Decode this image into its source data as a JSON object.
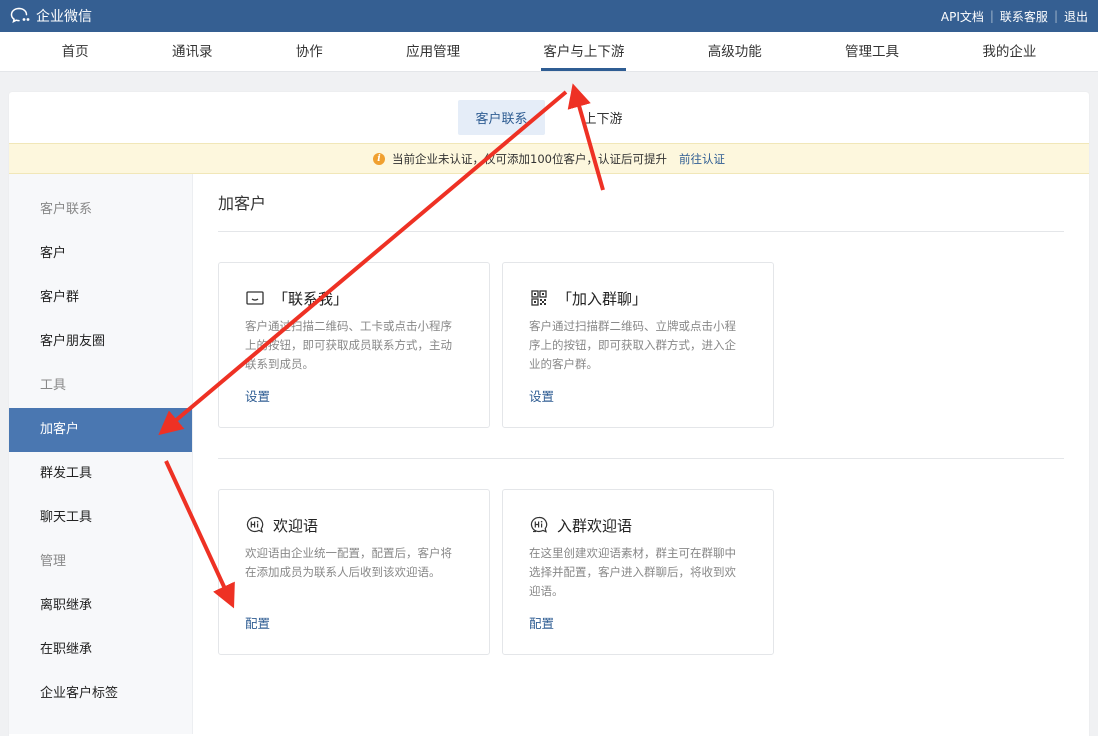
{
  "app": {
    "name": "企业微信"
  },
  "toplinks": {
    "api_docs": "API文档",
    "support": "联系客服",
    "logout": "退出"
  },
  "nav": {
    "items": [
      "首页",
      "通讯录",
      "协作",
      "应用管理",
      "客户与上下游",
      "高级功能",
      "管理工具",
      "我的企业"
    ],
    "active_index": 4
  },
  "subtabs": {
    "items": [
      "客户联系",
      "上下游"
    ],
    "active_index": 0
  },
  "notice": {
    "text": "当前企业未认证，仅可添加100位客户，认证后可提升",
    "link": "前往认证"
  },
  "sidebar": {
    "groups": [
      {
        "title": "客户联系",
        "items": [
          "客户",
          "客户群",
          "客户朋友圈"
        ]
      },
      {
        "title": "工具",
        "items": [
          "加客户",
          "群发工具",
          "聊天工具"
        ]
      },
      {
        "title": "管理",
        "items": [
          "离职继承",
          "在职继承",
          "企业客户标签"
        ]
      }
    ],
    "active": "加客户"
  },
  "page": {
    "title": "加客户"
  },
  "cards": [
    {
      "icon": "contact-me-icon",
      "title": "「联系我」",
      "desc": "客户通过扫描二维码、工卡或点击小程序上的按钮，即可获取成员联系方式，主动联系到成员。",
      "action": "设置"
    },
    {
      "icon": "qr-code-icon",
      "title": "「加入群聊」",
      "desc": "客户通过扫描群二维码、立牌或点击小程序上的按钮，即可获取入群方式，进入企业的客户群。",
      "action": "设置"
    },
    {
      "icon": "hi-bubble-icon",
      "title": "欢迎语",
      "desc": "欢迎语由企业统一配置，配置后，客户将在添加成员为联系人后收到该欢迎语。",
      "action": "配置"
    },
    {
      "icon": "group-hi-bubble-icon",
      "title": "入群欢迎语",
      "desc": "在这里创建欢迎语素材，群主可在群聊中选择并配置，客户进入群聊后，将收到欢迎语。",
      "action": "配置"
    }
  ],
  "colors": {
    "topbar": "#355f92",
    "active_side": "#4a77b1",
    "link": "#2f5d93",
    "arrow": "#ee3124"
  }
}
